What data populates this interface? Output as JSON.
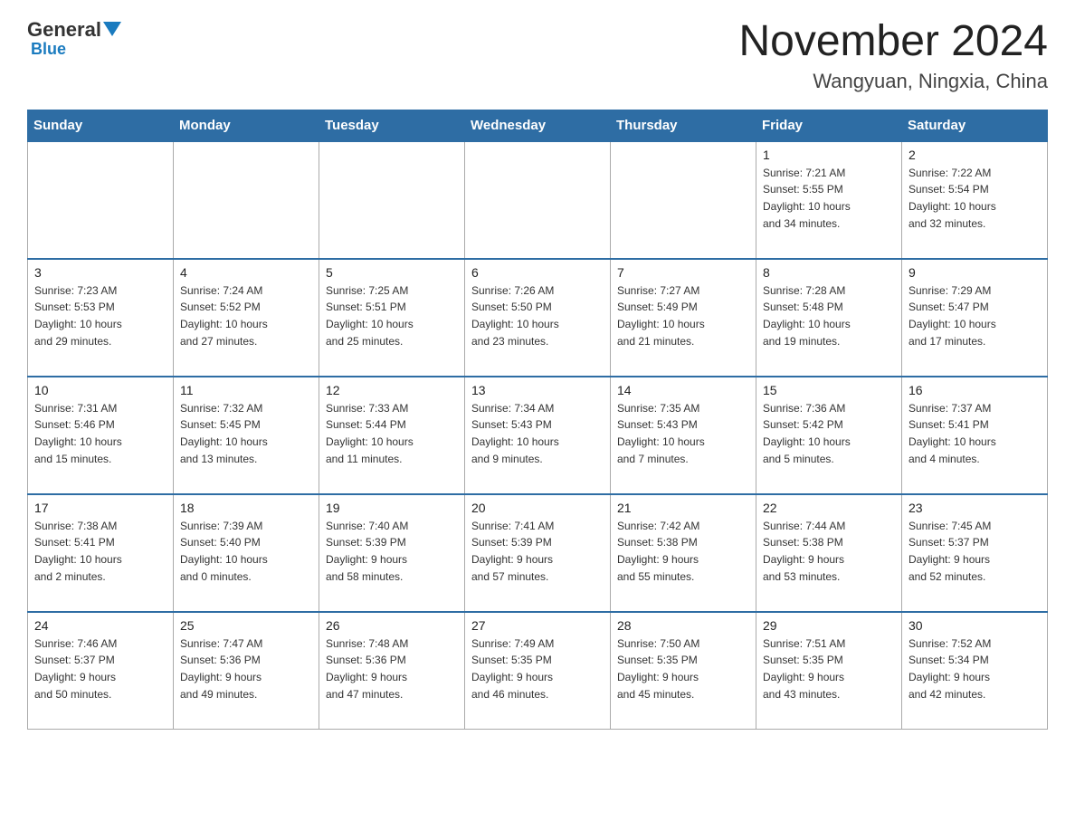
{
  "header": {
    "logo_general": "General",
    "logo_blue": "Blue",
    "title": "November 2024",
    "subtitle": "Wangyuan, Ningxia, China"
  },
  "weekdays": [
    "Sunday",
    "Monday",
    "Tuesday",
    "Wednesday",
    "Thursday",
    "Friday",
    "Saturday"
  ],
  "weeks": [
    [
      {
        "day": "",
        "info": ""
      },
      {
        "day": "",
        "info": ""
      },
      {
        "day": "",
        "info": ""
      },
      {
        "day": "",
        "info": ""
      },
      {
        "day": "",
        "info": ""
      },
      {
        "day": "1",
        "info": "Sunrise: 7:21 AM\nSunset: 5:55 PM\nDaylight: 10 hours\nand 34 minutes."
      },
      {
        "day": "2",
        "info": "Sunrise: 7:22 AM\nSunset: 5:54 PM\nDaylight: 10 hours\nand 32 minutes."
      }
    ],
    [
      {
        "day": "3",
        "info": "Sunrise: 7:23 AM\nSunset: 5:53 PM\nDaylight: 10 hours\nand 29 minutes."
      },
      {
        "day": "4",
        "info": "Sunrise: 7:24 AM\nSunset: 5:52 PM\nDaylight: 10 hours\nand 27 minutes."
      },
      {
        "day": "5",
        "info": "Sunrise: 7:25 AM\nSunset: 5:51 PM\nDaylight: 10 hours\nand 25 minutes."
      },
      {
        "day": "6",
        "info": "Sunrise: 7:26 AM\nSunset: 5:50 PM\nDaylight: 10 hours\nand 23 minutes."
      },
      {
        "day": "7",
        "info": "Sunrise: 7:27 AM\nSunset: 5:49 PM\nDaylight: 10 hours\nand 21 minutes."
      },
      {
        "day": "8",
        "info": "Sunrise: 7:28 AM\nSunset: 5:48 PM\nDaylight: 10 hours\nand 19 minutes."
      },
      {
        "day": "9",
        "info": "Sunrise: 7:29 AM\nSunset: 5:47 PM\nDaylight: 10 hours\nand 17 minutes."
      }
    ],
    [
      {
        "day": "10",
        "info": "Sunrise: 7:31 AM\nSunset: 5:46 PM\nDaylight: 10 hours\nand 15 minutes."
      },
      {
        "day": "11",
        "info": "Sunrise: 7:32 AM\nSunset: 5:45 PM\nDaylight: 10 hours\nand 13 minutes."
      },
      {
        "day": "12",
        "info": "Sunrise: 7:33 AM\nSunset: 5:44 PM\nDaylight: 10 hours\nand 11 minutes."
      },
      {
        "day": "13",
        "info": "Sunrise: 7:34 AM\nSunset: 5:43 PM\nDaylight: 10 hours\nand 9 minutes."
      },
      {
        "day": "14",
        "info": "Sunrise: 7:35 AM\nSunset: 5:43 PM\nDaylight: 10 hours\nand 7 minutes."
      },
      {
        "day": "15",
        "info": "Sunrise: 7:36 AM\nSunset: 5:42 PM\nDaylight: 10 hours\nand 5 minutes."
      },
      {
        "day": "16",
        "info": "Sunrise: 7:37 AM\nSunset: 5:41 PM\nDaylight: 10 hours\nand 4 minutes."
      }
    ],
    [
      {
        "day": "17",
        "info": "Sunrise: 7:38 AM\nSunset: 5:41 PM\nDaylight: 10 hours\nand 2 minutes."
      },
      {
        "day": "18",
        "info": "Sunrise: 7:39 AM\nSunset: 5:40 PM\nDaylight: 10 hours\nand 0 minutes."
      },
      {
        "day": "19",
        "info": "Sunrise: 7:40 AM\nSunset: 5:39 PM\nDaylight: 9 hours\nand 58 minutes."
      },
      {
        "day": "20",
        "info": "Sunrise: 7:41 AM\nSunset: 5:39 PM\nDaylight: 9 hours\nand 57 minutes."
      },
      {
        "day": "21",
        "info": "Sunrise: 7:42 AM\nSunset: 5:38 PM\nDaylight: 9 hours\nand 55 minutes."
      },
      {
        "day": "22",
        "info": "Sunrise: 7:44 AM\nSunset: 5:38 PM\nDaylight: 9 hours\nand 53 minutes."
      },
      {
        "day": "23",
        "info": "Sunrise: 7:45 AM\nSunset: 5:37 PM\nDaylight: 9 hours\nand 52 minutes."
      }
    ],
    [
      {
        "day": "24",
        "info": "Sunrise: 7:46 AM\nSunset: 5:37 PM\nDaylight: 9 hours\nand 50 minutes."
      },
      {
        "day": "25",
        "info": "Sunrise: 7:47 AM\nSunset: 5:36 PM\nDaylight: 9 hours\nand 49 minutes."
      },
      {
        "day": "26",
        "info": "Sunrise: 7:48 AM\nSunset: 5:36 PM\nDaylight: 9 hours\nand 47 minutes."
      },
      {
        "day": "27",
        "info": "Sunrise: 7:49 AM\nSunset: 5:35 PM\nDaylight: 9 hours\nand 46 minutes."
      },
      {
        "day": "28",
        "info": "Sunrise: 7:50 AM\nSunset: 5:35 PM\nDaylight: 9 hours\nand 45 minutes."
      },
      {
        "day": "29",
        "info": "Sunrise: 7:51 AM\nSunset: 5:35 PM\nDaylight: 9 hours\nand 43 minutes."
      },
      {
        "day": "30",
        "info": "Sunrise: 7:52 AM\nSunset: 5:34 PM\nDaylight: 9 hours\nand 42 minutes."
      }
    ]
  ]
}
